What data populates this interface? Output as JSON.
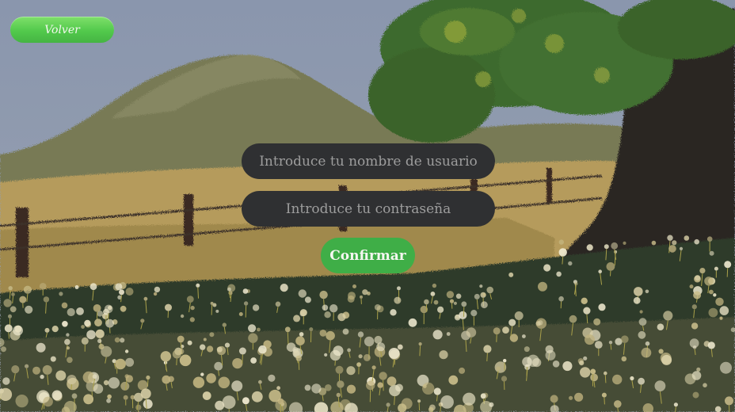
{
  "nav": {
    "back_label": "Volver"
  },
  "form": {
    "username_placeholder": "Introduce tu nombre de usuario",
    "password_placeholder": "Introduce tu contraseña",
    "confirm_label": "Confirmar"
  },
  "theme": {
    "sky": "#8f9bb0",
    "hill": "#7a7c58",
    "field": "#b39a5a",
    "foliage": "#3f6a2e",
    "trunk": "#2b2724",
    "meadow": "#2e3a2c",
    "input_bg": "#2f3032",
    "button_green": "#3fae47"
  }
}
